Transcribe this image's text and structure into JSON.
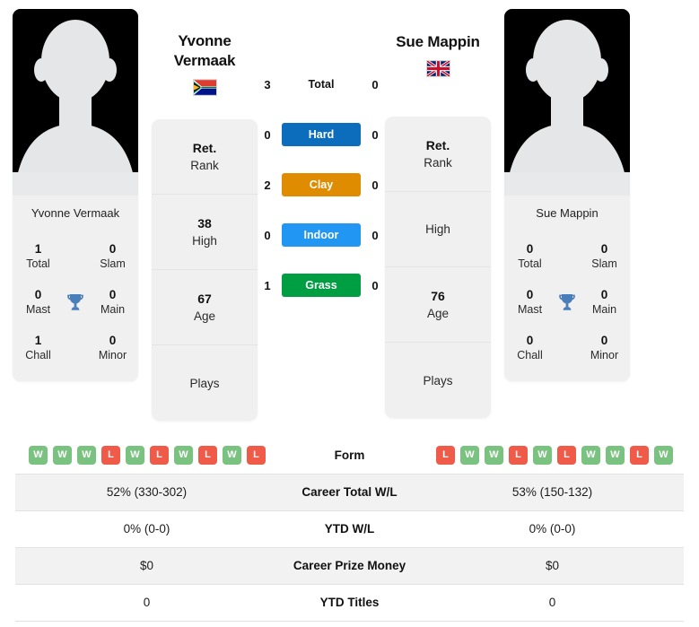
{
  "colors": {
    "hard": "#0d6dbd",
    "clay": "#e08c00",
    "indoor": "#2196f3",
    "grass": "#009e42",
    "win": "#7ac27f",
    "loss": "#ef5a49",
    "trophy": "#4a7ebb",
    "card_bg": "#f0f0f0"
  },
  "players": {
    "left": {
      "name_line1": "Yvonne",
      "name_line2": "Vermaak",
      "full_name": "Yvonne Vermaak",
      "country": "South Africa",
      "flag_icon": "flag-south-africa",
      "avatar_icon": "player-silhouette",
      "titles": [
        {
          "num": "1",
          "label": "Total"
        },
        {
          "num": "0",
          "label": "Slam"
        },
        {
          "num": "0",
          "label": "Mast"
        },
        {
          "num": "0",
          "label": "Main"
        },
        {
          "num": "1",
          "label": "Chall"
        },
        {
          "num": "0",
          "label": "Minor"
        }
      ],
      "rank_cells": [
        {
          "num": "Ret.",
          "label": "Rank"
        },
        {
          "num": "38",
          "label": "High"
        },
        {
          "num": "67",
          "label": "Age"
        },
        {
          "num": "",
          "label": "Plays"
        }
      ],
      "h2h": {
        "total": "3",
        "hard": "0",
        "clay": "2",
        "indoor": "0",
        "grass": "1"
      },
      "form": [
        "W",
        "W",
        "W",
        "L",
        "W",
        "L",
        "W",
        "L",
        "W",
        "L"
      ],
      "career_total_wl": "52% (330-302)",
      "ytd_wl": "0% (0-0)",
      "career_prize_money": "$0",
      "ytd_titles": "0"
    },
    "right": {
      "name_line1": "Sue Mappin",
      "name_line2": "",
      "full_name": "Sue Mappin",
      "country": "United Kingdom",
      "flag_icon": "flag-united-kingdom",
      "avatar_icon": "player-silhouette",
      "titles": [
        {
          "num": "0",
          "label": "Total"
        },
        {
          "num": "0",
          "label": "Slam"
        },
        {
          "num": "0",
          "label": "Mast"
        },
        {
          "num": "0",
          "label": "Main"
        },
        {
          "num": "0",
          "label": "Chall"
        },
        {
          "num": "0",
          "label": "Minor"
        }
      ],
      "rank_cells": [
        {
          "num": "Ret.",
          "label": "Rank"
        },
        {
          "num": "",
          "label": "High"
        },
        {
          "num": "76",
          "label": "Age"
        },
        {
          "num": "",
          "label": "Plays"
        }
      ],
      "h2h": {
        "total": "0",
        "hard": "0",
        "clay": "0",
        "indoor": "0",
        "grass": "0"
      },
      "form": [
        "L",
        "W",
        "W",
        "L",
        "W",
        "L",
        "W",
        "W",
        "L",
        "W"
      ],
      "career_total_wl": "53% (150-132)",
      "ytd_wl": "0% (0-0)",
      "career_prize_money": "$0",
      "ytd_titles": "0"
    }
  },
  "surfaces": [
    {
      "key": "total",
      "label": "Total",
      "chip": false
    },
    {
      "key": "hard",
      "label": "Hard",
      "chip": true
    },
    {
      "key": "clay",
      "label": "Clay",
      "chip": true
    },
    {
      "key": "indoor",
      "label": "Indoor",
      "chip": true
    },
    {
      "key": "grass",
      "label": "Grass",
      "chip": true
    }
  ],
  "table_rows": [
    {
      "key": "form",
      "label": "Form"
    },
    {
      "key": "career",
      "label": "Career Total W/L"
    },
    {
      "key": "ytdwl",
      "label": "YTD W/L"
    },
    {
      "key": "prize",
      "label": "Career Prize Money"
    },
    {
      "key": "titles",
      "label": "YTD Titles"
    }
  ],
  "trophy_icon": "trophy-icon"
}
